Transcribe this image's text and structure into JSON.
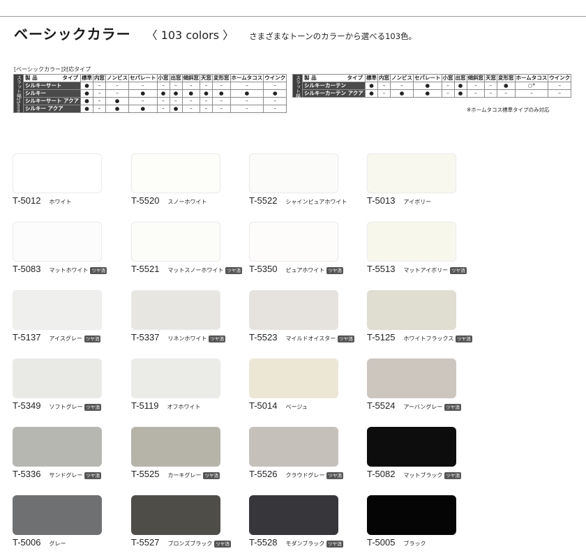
{
  "header": {
    "title": "ベーシックカラー",
    "subtitle": "〈 103 colors 〉",
    "description": "さまざまなトーンのカラーから選べる103色。"
  },
  "table_caption": "[ベーシックカラー]対応タイプ",
  "table1": {
    "side_label": "スラット幅25mm",
    "name_header": "製 品",
    "type_header": "タイプ",
    "columns": [
      "標準",
      "内窓",
      "ノンビス",
      "セパレート",
      "小窓",
      "出窓",
      "傾斜窓",
      "天窓",
      "変形窓",
      "ホームタコス",
      "ウインク"
    ],
    "rows": [
      {
        "name": "シルキーサート",
        "cells": [
          "●",
          "–",
          "–",
          "–",
          "–",
          "–",
          "–",
          "–",
          "–",
          "–",
          "–"
        ]
      },
      {
        "name": "シルキー",
        "cells": [
          "●",
          "–",
          "–",
          "●",
          "●",
          "●",
          "●",
          "●",
          "●",
          "●",
          "●"
        ]
      },
      {
        "name": "シルキーサート アクア",
        "cells": [
          "●",
          "–",
          "●",
          "–",
          "–",
          "–",
          "–",
          "–",
          "–",
          "–",
          "–"
        ]
      },
      {
        "name": "シルキー アクア",
        "cells": [
          "●",
          "–",
          "●",
          "●",
          "–",
          "●",
          "–",
          "–",
          "–",
          "–",
          "–"
        ]
      }
    ]
  },
  "table2": {
    "side_label": "スラット幅15mm",
    "name_header": "製 品",
    "type_header": "タイプ",
    "columns": [
      "標準",
      "内窓",
      "ノンビス",
      "セパレート",
      "小窓",
      "出窓",
      "傾斜窓",
      "天窓",
      "変形窓",
      "ホームタコス",
      "ウインク"
    ],
    "rows": [
      {
        "name": "シルキーカーテン",
        "cells": [
          "●",
          "–",
          "–",
          "●",
          "–",
          "●",
          "–",
          "–",
          "●",
          "○*",
          "–"
        ]
      },
      {
        "name": "シルキーカーテン アクア",
        "cells": [
          "●",
          "–",
          "●",
          "●",
          "–",
          "●",
          "–",
          "–",
          "–",
          "–",
          "–"
        ]
      }
    ]
  },
  "note": "※ホームタコス標準タイプのみ対応",
  "badge_text": "ツヤ消",
  "swatches": [
    {
      "code": "T-5012",
      "name": "ホワイト",
      "color": "#ffffff",
      "matte": false
    },
    {
      "code": "T-5520",
      "name": "スノーホワイト",
      "color": "#fdfdfa",
      "matte": false
    },
    {
      "code": "T-5522",
      "name": "シャインピュアホワイト",
      "color": "#fbfbf9",
      "matte": false
    },
    {
      "code": "T-5013",
      "name": "アイボリー",
      "color": "#f9f8ee",
      "matte": false
    },
    {
      "code": "T-5083",
      "name": "マットホワイト",
      "color": "#fcfcfd",
      "matte": true
    },
    {
      "code": "T-5521",
      "name": "マットスノーホワイト",
      "color": "#fcfcf8",
      "matte": true
    },
    {
      "code": "T-5350",
      "name": "ピュアホワイト",
      "color": "#fdfcfa",
      "matte": true
    },
    {
      "code": "T-5513",
      "name": "マットアイボリー",
      "color": "#f8f7ec",
      "matte": true
    },
    {
      "code": "T-5137",
      "name": "アイスグレー",
      "color": "#efefed",
      "matte": true
    },
    {
      "code": "T-5337",
      "name": "リネンホワイト",
      "color": "#e8e6e1",
      "matte": true
    },
    {
      "code": "T-5523",
      "name": "マイルドオイスター",
      "color": "#e6e3df",
      "matte": true
    },
    {
      "code": "T-5125",
      "name": "ホワイトフラックス",
      "color": "#e0ddd1",
      "matte": true
    },
    {
      "code": "T-5349",
      "name": "ソフトグレー",
      "color": "#e9e9e6",
      "matte": true
    },
    {
      "code": "T-5119",
      "name": "オフホワイト",
      "color": "#ebebe8",
      "matte": false
    },
    {
      "code": "T-5014",
      "name": "ベージュ",
      "color": "#ece7d5",
      "matte": false
    },
    {
      "code": "T-5524",
      "name": "アーバングレー",
      "color": "#cdc6bf",
      "matte": true
    },
    {
      "code": "T-5336",
      "name": "サンドグレー",
      "color": "#b7b7b2",
      "matte": true
    },
    {
      "code": "T-5525",
      "name": "カーキグレー",
      "color": "#b6b3a9",
      "matte": true
    },
    {
      "code": "T-5526",
      "name": "クラウドグレー",
      "color": "#c6c0bb",
      "matte": true
    },
    {
      "code": "T-5082",
      "name": "マットブラック",
      "color": "#0d0d0d",
      "matte": true
    },
    {
      "code": "T-5006",
      "name": "グレー",
      "color": "#6f7072",
      "matte": false
    },
    {
      "code": "T-5527",
      "name": "ブロンズブラック",
      "color": "#4f4d47",
      "matte": true
    },
    {
      "code": "T-5528",
      "name": "モダンブラック",
      "color": "#37363a",
      "matte": true
    },
    {
      "code": "T-5005",
      "name": "ブラック",
      "color": "#050505",
      "matte": false
    }
  ]
}
